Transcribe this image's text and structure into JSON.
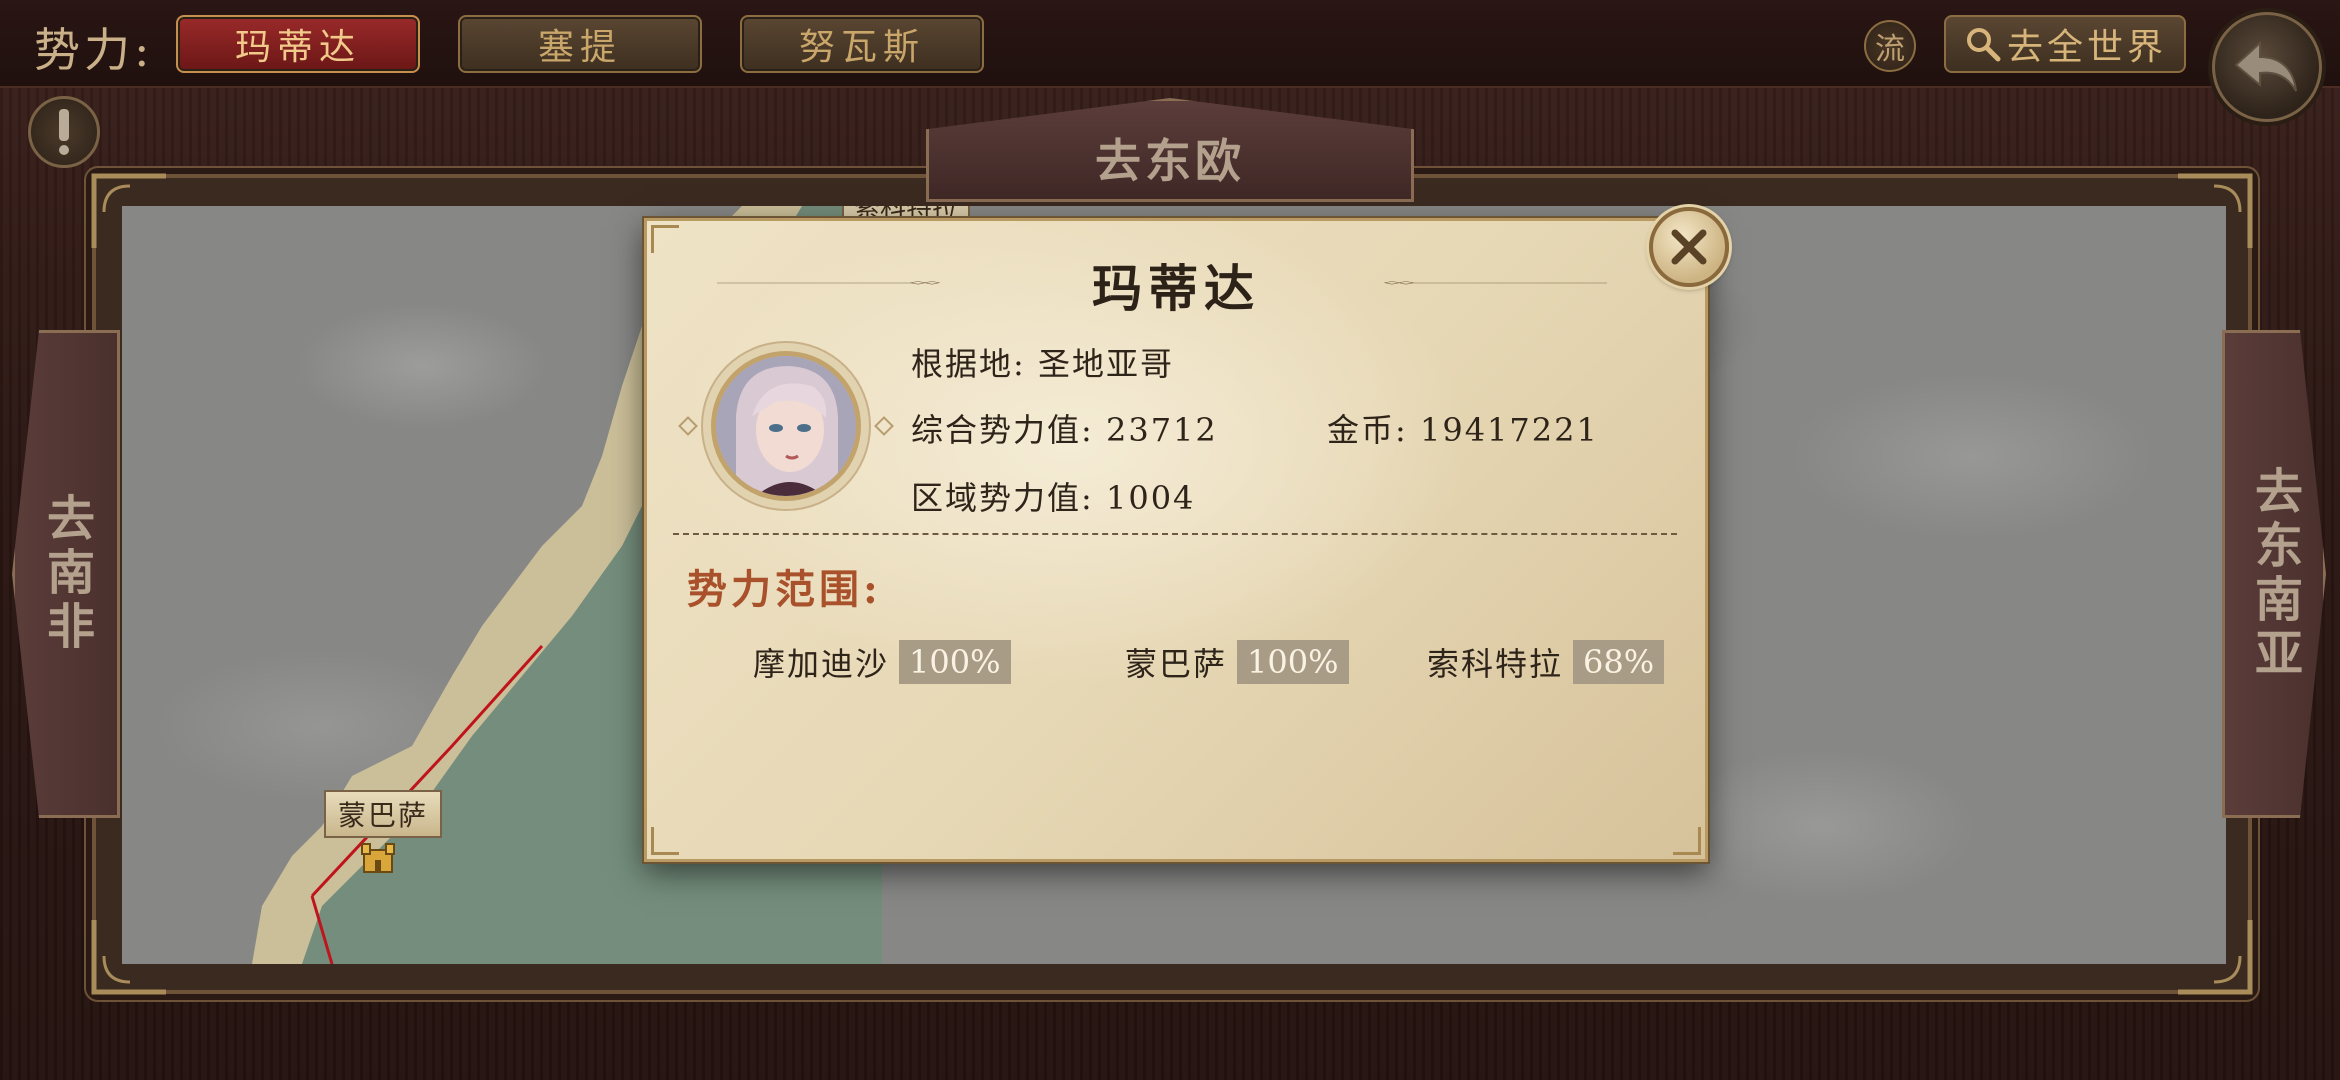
{
  "topbar": {
    "label": "势力:",
    "factions": [
      {
        "label": "玛蒂达",
        "active": true
      },
      {
        "label": "塞提",
        "active": false
      },
      {
        "label": "努瓦斯",
        "active": false
      }
    ],
    "circle_label": "流",
    "world_button": "去全世界",
    "icons": {
      "search": "search-icon",
      "back": "back-arrow-icon",
      "alert": "exclamation-icon"
    }
  },
  "nav": {
    "top": "去东欧",
    "left": "去南非",
    "right": "去东南亚"
  },
  "map": {
    "city": "蒙巴萨",
    "partial_label_top": "索科特拉"
  },
  "dialog": {
    "title": "玛蒂达",
    "base_label": "根据地:",
    "base_value": "圣地亚哥",
    "power_label": "综合势力值:",
    "power_value": "23712",
    "gold_label": "金币:",
    "gold_value": "19417221",
    "region_power_label": "区域势力值:",
    "region_power_value": "1004",
    "range_title": "势力范围:",
    "regions": [
      {
        "name": "摩加迪沙",
        "pct": "100%"
      },
      {
        "name": "蒙巴萨",
        "pct": "100%"
      },
      {
        "name": "索科特拉",
        "pct": "68%"
      }
    ]
  },
  "colors": {
    "active_tab": "#8a2020",
    "accent_orange": "#a8512b",
    "parchment": "#efe3c6",
    "route_red": "#c0141c"
  }
}
